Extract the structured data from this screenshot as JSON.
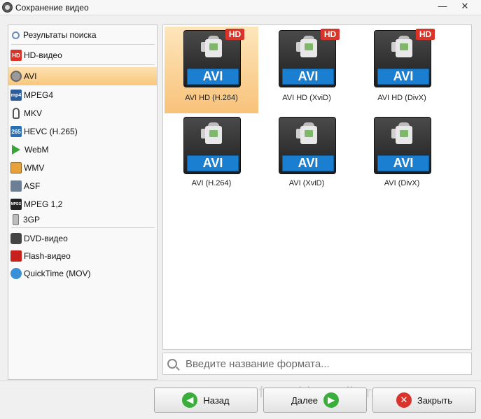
{
  "window": {
    "title": "Сохранение видео",
    "minimize_glyph": "—",
    "close_glyph": "✕"
  },
  "sidebar": {
    "items": [
      {
        "label": "Результаты поиска",
        "icon": "search-icon"
      },
      {
        "label": "HD-видео",
        "icon": "hd-icon",
        "icon_text": "HD"
      },
      {
        "label": "AVI",
        "icon": "film-reel-icon",
        "selected": true
      },
      {
        "label": "MPEG4",
        "icon": "mp4-icon",
        "icon_text": "mp4"
      },
      {
        "label": "MKV",
        "icon": "mkv-icon"
      },
      {
        "label": "HEVC (H.265)",
        "icon": "hevc-icon",
        "icon_text": "265"
      },
      {
        "label": "WebM",
        "icon": "webm-play-icon"
      },
      {
        "label": "WMV",
        "icon": "wmv-icon"
      },
      {
        "label": "ASF",
        "icon": "asf-icon"
      },
      {
        "label": "MPEG 1,2",
        "icon": "mpeg-icon",
        "icon_text": "MPEG"
      },
      {
        "label": "3GP",
        "icon": "phone-icon"
      },
      {
        "label": "DVD-видео",
        "icon": "dvd-icon"
      },
      {
        "label": "Flash-видео",
        "icon": "flash-icon"
      },
      {
        "label": "QuickTime (MOV)",
        "icon": "quicktime-icon"
      }
    ]
  },
  "formats": [
    {
      "caption": "AVI HD (H.264)",
      "badge": "AVI",
      "hd": "HD",
      "selected": true
    },
    {
      "caption": "AVI HD (XviD)",
      "badge": "AVI",
      "hd": "HD"
    },
    {
      "caption": "AVI HD (DivX)",
      "badge": "AVI",
      "hd": "HD"
    },
    {
      "caption": "AVI (H.264)",
      "badge": "AVI"
    },
    {
      "caption": "AVI (XviD)",
      "badge": "AVI"
    },
    {
      "caption": "AVI (DivX)",
      "badge": "AVI"
    }
  ],
  "search": {
    "placeholder": "Введите название формата..."
  },
  "buttons": {
    "back": "Назад",
    "next": "Далее",
    "close": "Закрыть"
  },
  "watermark": "free-video-editors.ru",
  "colors": {
    "selection": "#f9c77c",
    "badge_blue": "#1a7fd0",
    "hd_red": "#d8342a",
    "go_green": "#3aae3a",
    "close_red": "#d9342b"
  }
}
